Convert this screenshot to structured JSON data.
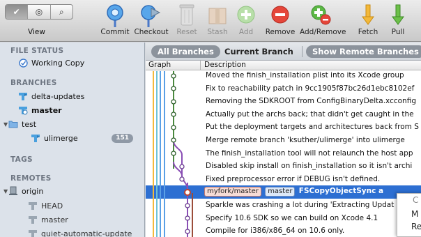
{
  "toolbar": {
    "view_label": "View",
    "view_segments": [
      "✔",
      "◎",
      "⌕"
    ],
    "items": [
      {
        "id": "commit",
        "label": "Commit"
      },
      {
        "id": "checkout",
        "label": "Checkout"
      },
      {
        "id": "reset",
        "label": "Reset"
      },
      {
        "id": "stash",
        "label": "Stash"
      },
      {
        "id": "add",
        "label": "Add"
      },
      {
        "id": "remove",
        "label": "Remove"
      },
      {
        "id": "add_remove",
        "label": "Add/Remove"
      },
      {
        "id": "fetch",
        "label": "Fetch"
      },
      {
        "id": "pull",
        "label": "Pull"
      }
    ]
  },
  "sidebar": {
    "file_status": "FILE STATUS",
    "working_copy": "Working Copy",
    "branches": "BRANCHES",
    "branch_items": [
      "delta-updates",
      "master"
    ],
    "folder": "test",
    "sub_branch": "ulimerge",
    "sub_branch_count": "151",
    "tags": "TAGS",
    "remotes": "REMOTES",
    "remote_name": "origin",
    "remote_branches": [
      "HEAD",
      "master",
      "quiet-automatic-update"
    ]
  },
  "scope": {
    "all": "All Branches",
    "current": "Current Branch",
    "remote": "Show Remote Branches"
  },
  "columns": {
    "graph": "Graph",
    "description": "Description"
  },
  "commits": [
    "Moved the finish_installation plist into its Xcode group",
    "Fix to reachability patch in 9cc1905f87bc26d1ebc8102ef",
    "Removing the SDKROOT from ConfigBinaryDelta.xcconfig",
    "Actually put the archs back; that didn't get caught in the",
    "Put the deployment targets and architectures back from S",
    "Merge remote branch 'ksuther/ulimerge' into ulimerge",
    "The finish_installation tool will not relaunch the host app",
    "Disabled skip install on finish_installation so it isn't archi",
    "Fixed preprocessor error if DEBUG isn't defined.",
    "",
    "Sparkle was crashing a lot during 'Extracting Updat",
    "Specify 10.6 SDK so we can build on Xcode 4.1",
    "Compile for i386/x86_64 on 10.6 only."
  ],
  "selected_commit": {
    "tag_remote": "myfork/master",
    "tag_local": "master",
    "message": "FSCopyObjectSync a"
  },
  "popup": {
    "lines": [
      "C",
      "M",
      "Re"
    ]
  },
  "colors": {
    "accent": "#2d6fd2",
    "graph_blue": "#5aa0e6",
    "graph_purple": "#8a4fb5",
    "graph_green": "#4a8a3e"
  }
}
